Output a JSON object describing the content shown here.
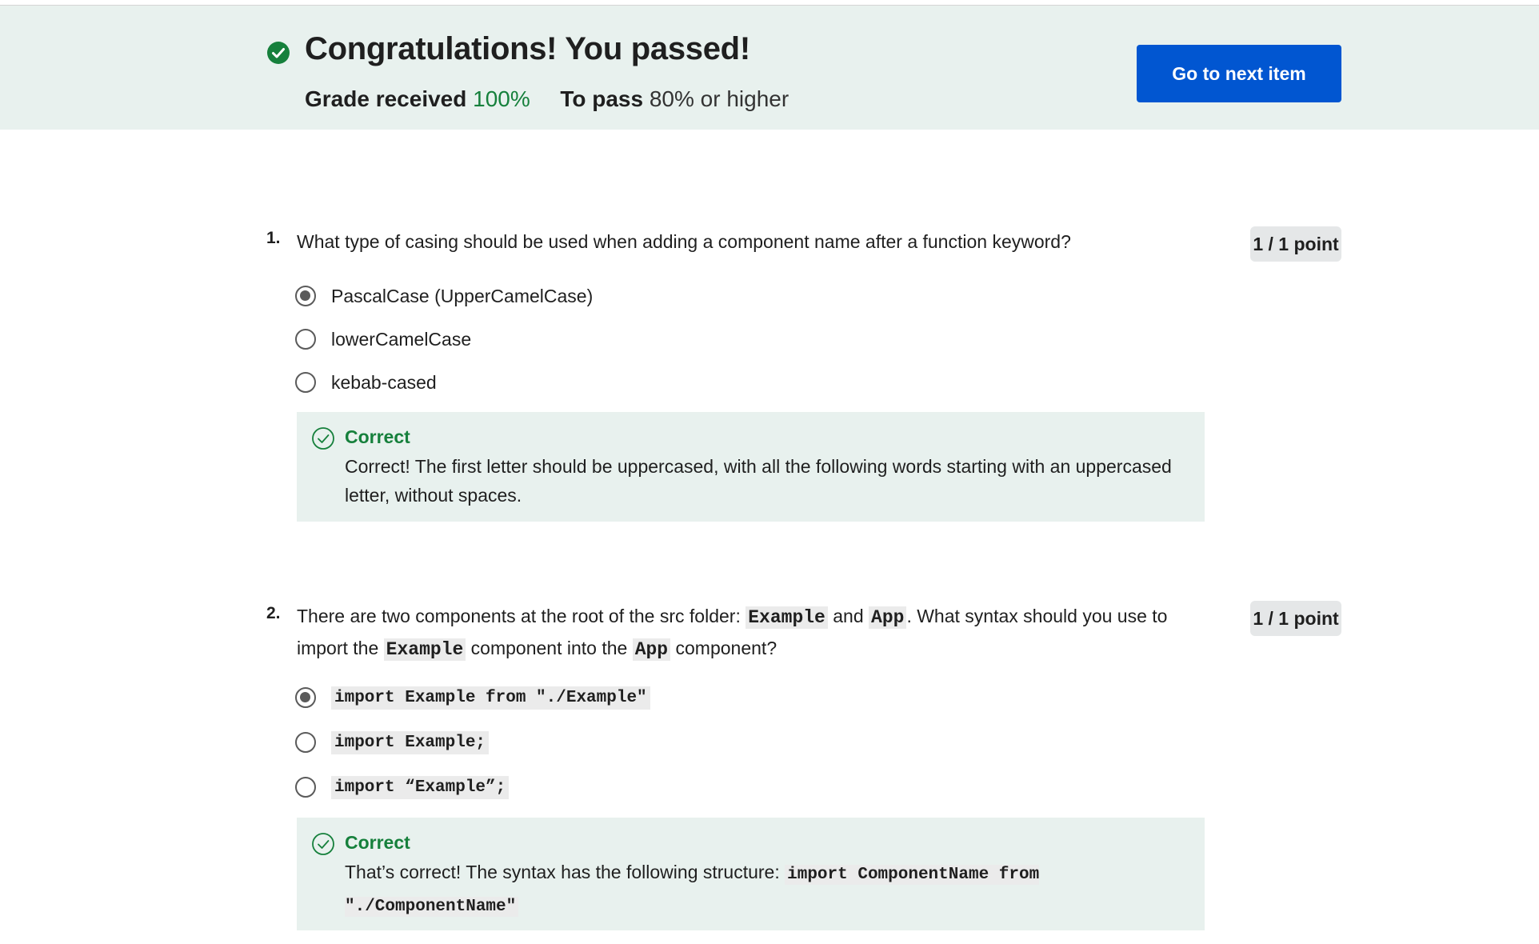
{
  "banner": {
    "title": "Congratulations! You passed!",
    "grade_label": "Grade received",
    "grade_value": "100%",
    "pass_label": "To pass",
    "pass_value": "80% or higher",
    "next_button": "Go to next item"
  },
  "colors": {
    "banner_bg": "#e8f1ee",
    "success_green": "#16803c",
    "primary_blue": "#0156d1",
    "points_badge_bg": "#e5e7e8"
  },
  "questions": [
    {
      "number": "1.",
      "text": "What type of casing should be used when adding a component name after a function keyword?",
      "points": "1 / 1 point",
      "options": [
        {
          "label": "PascalCase (UpperCamelCase)",
          "selected": true
        },
        {
          "label": "lowerCamelCase",
          "selected": false
        },
        {
          "label": "kebab-cased",
          "selected": false
        }
      ],
      "feedback": {
        "title": "Correct",
        "text": "Correct! The first letter should be uppercased, with all the following words starting with an uppercased letter, without spaces."
      }
    },
    {
      "number": "2.",
      "text_parts": {
        "p1": "There are two components at the root of the src folder: ",
        "c1": "Example",
        "p2": " and ",
        "c2": "App",
        "p3": ". What syntax should you use to import the ",
        "c3": "Example",
        "p4": " component into the ",
        "c4": "App",
        "p5": " component?"
      },
      "points": "1 / 1 point",
      "options": [
        {
          "label": "import Example from \"./Example\"",
          "selected": true
        },
        {
          "label": "import Example;",
          "selected": false
        },
        {
          "label": "import “Example”;",
          "selected": false
        }
      ],
      "feedback": {
        "title": "Correct",
        "text": "That’s correct! The syntax has the following structure: ",
        "code": "import ComponentName from \"./ComponentName\""
      }
    }
  ]
}
